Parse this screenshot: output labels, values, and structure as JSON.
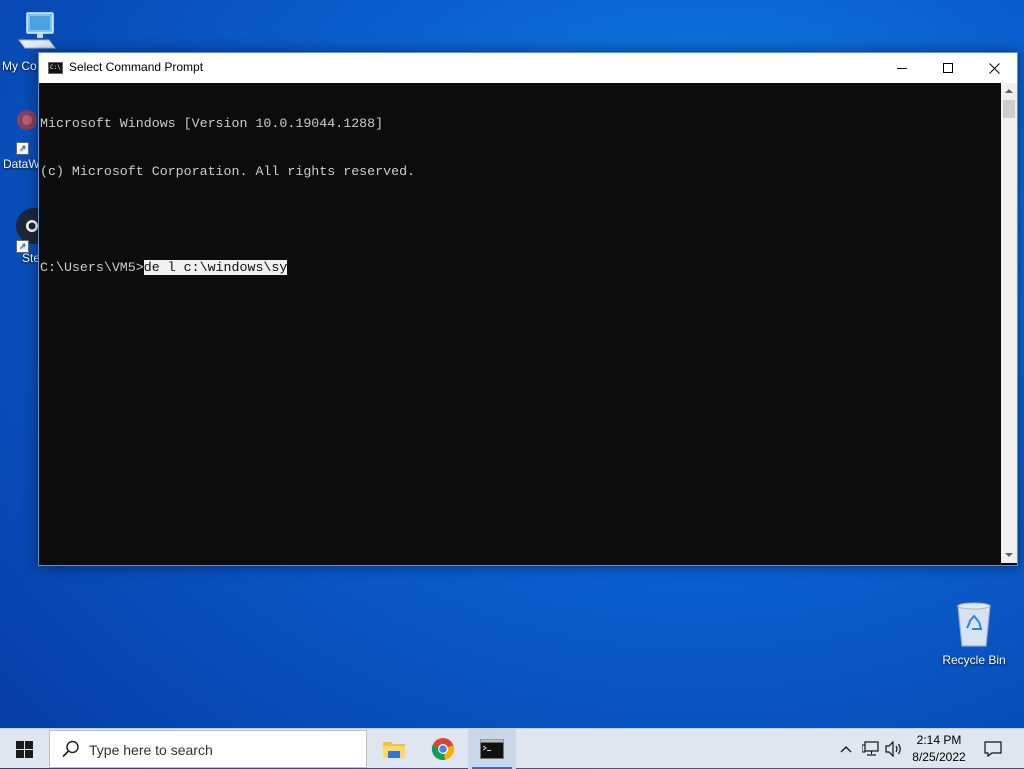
{
  "desktop": {
    "icons": [
      {
        "label": "My Co"
      },
      {
        "label": "DataW"
      },
      {
        "label": "Ste"
      },
      {
        "label": "Recycle Bin"
      }
    ]
  },
  "window": {
    "title": "Select Command Prompt",
    "console_lines": [
      "Microsoft Windows [Version 10.0.19044.1288]",
      "(c) Microsoft Corporation. All rights reserved.",
      ""
    ],
    "prompt": "C:\\Users\\VM5>",
    "selected_input": "de l c:\\windows\\sy"
  },
  "taskbar": {
    "search_placeholder": "Type here to search",
    "apps": [
      "file-explorer",
      "chrome",
      "command-prompt"
    ],
    "clock_time": "2:14 PM",
    "clock_date": "8/25/2022"
  },
  "colors": {
    "console_bg": "#0c0c0c",
    "console_fg": "#cccccc",
    "taskbar_bg": "#dfe6ef",
    "accent": "#2c6fc5"
  }
}
